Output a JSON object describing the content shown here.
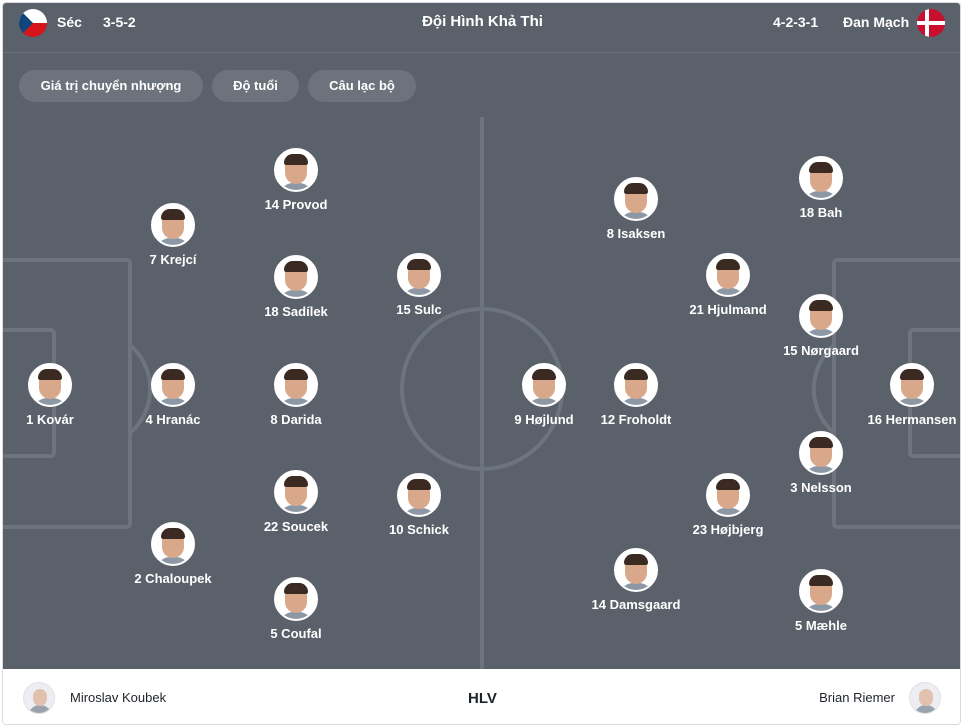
{
  "header": {
    "home_team": "Séc",
    "home_formation": "3-5-2",
    "title": "Đội Hình Khả Thi",
    "away_formation": "4-2-3-1",
    "away_team": "Đan Mạch"
  },
  "filters": [
    "Giá trị chuyển nhượng",
    "Độ tuổi",
    "Câu lạc bộ"
  ],
  "home_players": [
    {
      "number": "1",
      "name": "Kovár",
      "label": "1 Kovár"
    },
    {
      "number": "7",
      "name": "Krejcí",
      "label": "7 Krejcí"
    },
    {
      "number": "4",
      "name": "Hranác",
      "label": "4 Hranác"
    },
    {
      "number": "2",
      "name": "Chaloupek",
      "label": "2 Chaloupek"
    },
    {
      "number": "14",
      "name": "Provod",
      "label": "14 Provod"
    },
    {
      "number": "18",
      "name": "Sadílek",
      "label": "18 Sadílek"
    },
    {
      "number": "8",
      "name": "Darida",
      "label": "8 Darida"
    },
    {
      "number": "22",
      "name": "Soucek",
      "label": "22 Soucek"
    },
    {
      "number": "5",
      "name": "Coufal",
      "label": "5 Coufal"
    },
    {
      "number": "15",
      "name": "Sulc",
      "label": "15 Sulc"
    },
    {
      "number": "10",
      "name": "Schick",
      "label": "10 Schick"
    }
  ],
  "away_players": [
    {
      "number": "9",
      "name": "Højlund",
      "label": "9 Højlund"
    },
    {
      "number": "8",
      "name": "Isaksen",
      "label": "8 Isaksen"
    },
    {
      "number": "12",
      "name": "Froholdt",
      "label": "12 Froholdt"
    },
    {
      "number": "14",
      "name": "Damsgaard",
      "label": "14 Damsgaard"
    },
    {
      "number": "21",
      "name": "Hjulmand",
      "label": "21 Hjulmand"
    },
    {
      "number": "23",
      "name": "Højbjerg",
      "label": "23 Højbjerg"
    },
    {
      "number": "18",
      "name": "Bah",
      "label": "18 Bah"
    },
    {
      "number": "15",
      "name": "Nørgaard",
      "label": "15 Nørgaard"
    },
    {
      "number": "3",
      "name": "Nelsson",
      "label": "3 Nelsson"
    },
    {
      "number": "5",
      "name": "Mæhle",
      "label": "5 Mæhle"
    },
    {
      "number": "16",
      "name": "Hermansen",
      "label": "16 Hermansen"
    }
  ],
  "footer": {
    "home_coach": "Miroslav Koubek",
    "label": "HLV",
    "away_coach": "Brian Riemer"
  },
  "colors": {
    "pitch": "#5a616b",
    "chip": "#6c737d",
    "lines": "#6d747e",
    "czech_red": "#d7141a",
    "czech_blue": "#11457e",
    "denmark_red": "#c8102e"
  }
}
